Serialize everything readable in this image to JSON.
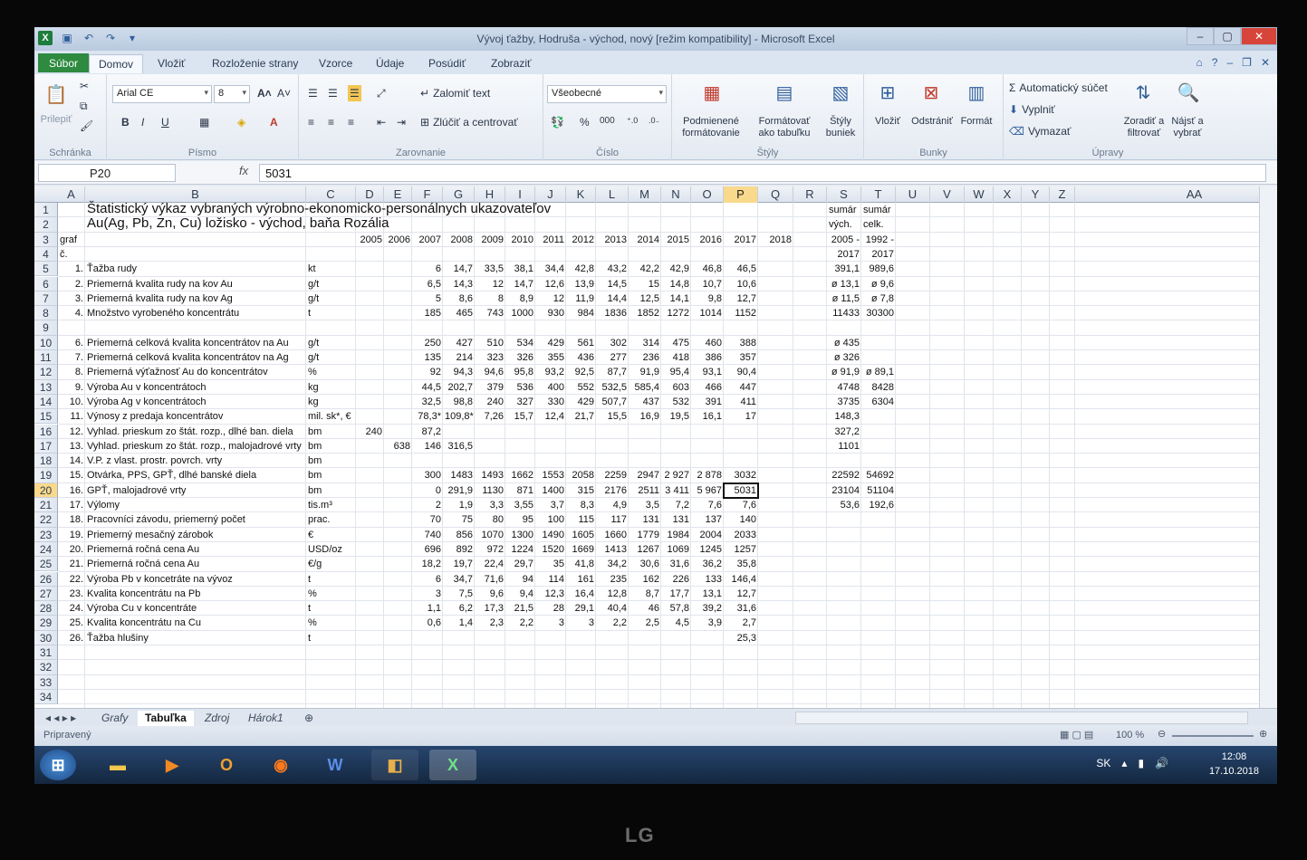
{
  "window": {
    "title": "Vývoj ťažby, Hodruša - východ, nový  [režim kompatibility]  -  Microsoft Excel"
  },
  "ribbon_tabs": [
    "Súbor",
    "Domov",
    "Vložiť",
    "Rozloženie strany",
    "Vzorce",
    "Údaje",
    "Posúdiť",
    "Zobraziť"
  ],
  "ribbon": {
    "paste": "Prilepiť",
    "clipboard": "Schránka",
    "font_name": "Arial CE",
    "font_size": "8",
    "font_group": "Písmo",
    "bold": "B",
    "italic": "I",
    "underline": "U",
    "wrap": "Zalomiť text",
    "merge": "Zlúčiť a centrovať",
    "align_group": "Zarovnanie",
    "numfmt": "Všeobecné",
    "number_group": "Číslo",
    "percent": "%",
    "thousands": "000",
    "cond_fmt": "Podmienené\nformátovanie",
    "fmt_table": "Formátovať\nako tabuľku",
    "cell_styles": "Štýly\nbuniek",
    "styles_group": "Štýly",
    "insert": "Vložiť",
    "delete": "Odstrániť",
    "format": "Formát",
    "cells_group": "Bunky",
    "autosum": "Automatický súčet",
    "fill": "Vyplniť",
    "clear": "Vymazať",
    "sort": "Zoradiť a\nfiltrovať",
    "find": "Nájsť a\nvybrať",
    "edit_group": "Úpravy"
  },
  "formula_bar": {
    "name_box": "P20",
    "fx": "fx",
    "value": "5031"
  },
  "columns": [
    "A",
    "B",
    "C",
    "D",
    "E",
    "F",
    "G",
    "H",
    "I",
    "J",
    "K",
    "L",
    "M",
    "N",
    "O",
    "P",
    "Q",
    "R",
    "S",
    "T",
    "U",
    "V",
    "W",
    "X",
    "Y",
    "Z",
    "AA"
  ],
  "selected_col": "P",
  "selected_row": 20,
  "sheet": {
    "title1": "Štatistický výkaz vybraných výrobno-ekonomicko-personálnych ukazovateľov",
    "title2": "Au(Ag, Pb, Zn, Cu) ložisko - východ, baňa Rozália",
    "graf": "graf",
    "c": "č.",
    "years": [
      "2005",
      "2006",
      "2007",
      "2008",
      "2009",
      "2010",
      "2011",
      "2012",
      "2013",
      "2014",
      "2015",
      "2016",
      "2017",
      "2018"
    ],
    "s_head": [
      "sumár",
      "vých.",
      "2005 -",
      "2017"
    ],
    "t_head": [
      "sumár",
      "celk.",
      "1992 -",
      "2017"
    ],
    "rows": [
      {
        "r": 5,
        "a": "1.",
        "b": "Ťažba rudy",
        "c": "kt",
        "f": "6",
        "g": "14,7",
        "h": "33,5",
        "i": "38,1",
        "j": "34,4",
        "k": "42,8",
        "l": "43,2",
        "m": "42,2",
        "n": "42,9",
        "o": "46,8",
        "p": "46,5",
        "s": "391,1",
        "t": "989,6"
      },
      {
        "r": 6,
        "a": "2.",
        "b": "Priemerná kvalita rudy na kov Au",
        "c": "g/t",
        "f": "6,5",
        "g": "14,3",
        "h": "12",
        "i": "14,7",
        "j": "12,6",
        "k": "13,9",
        "l": "14,5",
        "m": "15",
        "n": "14,8",
        "o": "10,7",
        "p": "10,6",
        "s": "ø 13,1",
        "t": "ø 9,6"
      },
      {
        "r": 7,
        "a": "3.",
        "b": "Priemerná kvalita rudy na kov Ag",
        "c": "g/t",
        "f": "5",
        "g": "8,6",
        "h": "8",
        "i": "8,9",
        "j": "12",
        "k": "11,9",
        "l": "14,4",
        "m": "12,5",
        "n": "14,1",
        "o": "9,8",
        "p": "12,7",
        "s": "ø 11,5",
        "t": "ø 7,8"
      },
      {
        "r": 8,
        "a": "4.",
        "b": "Množstvo vyrobeného koncentrátu",
        "c": "t",
        "f": "185",
        "g": "465",
        "h": "743",
        "i": "1000",
        "j": "930",
        "k": "984",
        "l": "1836",
        "m": "1852",
        "n": "1272",
        "o": "1014",
        "p": "1152",
        "s": "11433",
        "t": "30300"
      },
      {
        "r": 10,
        "a": "6.",
        "b": "Priemerná celková kvalita koncentrátov na Au",
        "c": "g/t",
        "f": "250",
        "g": "427",
        "h": "510",
        "i": "534",
        "j": "429",
        "k": "561",
        "l": "302",
        "m": "314",
        "n": "475",
        "o": "460",
        "p": "388",
        "s": "ø 435",
        "t": ""
      },
      {
        "r": 11,
        "a": "7.",
        "b": "Priemerná celková kvalita koncentrátov na Ag",
        "c": "g/t",
        "f": "135",
        "g": "214",
        "h": "323",
        "i": "326",
        "j": "355",
        "k": "436",
        "l": "277",
        "m": "236",
        "n": "418",
        "o": "386",
        "p": "357",
        "s": "ø 326",
        "t": ""
      },
      {
        "r": 12,
        "a": "8.",
        "b": "Priemerná výťažnosť Au do koncentrátov",
        "c": "%",
        "f": "92",
        "g": "94,3",
        "h": "94,6",
        "i": "95,8",
        "j": "93,2",
        "k": "92,5",
        "l": "87,7",
        "m": "91,9",
        "n": "95,4",
        "o": "93,1",
        "p": "90,4",
        "s": "ø 91,9",
        "t": "ø 89,1"
      },
      {
        "r": 13,
        "a": "9.",
        "b": "Výroba Au v koncentrátoch",
        "c": "kg",
        "f": "44,5",
        "g": "202,7",
        "h": "379",
        "i": "536",
        "j": "400",
        "k": "552",
        "l": "532,5",
        "m": "585,4",
        "n": "603",
        "o": "466",
        "p": "447",
        "s": "4748",
        "t": "8428"
      },
      {
        "r": 14,
        "a": "10.",
        "b": "Výroba Ag v koncentrátoch",
        "c": "kg",
        "f": "32,5",
        "g": "98,8",
        "h": "240",
        "i": "327",
        "j": "330",
        "k": "429",
        "l": "507,7",
        "m": "437",
        "n": "532",
        "o": "391",
        "p": "411",
        "s": "3735",
        "t": "6304"
      },
      {
        "r": 15,
        "a": "11.",
        "b": "Výnosy z predaja koncentrátov",
        "c": "mil. sk*, €",
        "f": "78,3*",
        "g": "109,8*",
        "h": "7,26",
        "i": "15,7",
        "j": "12,4",
        "k": "21,7",
        "l": "15,5",
        "m": "16,9",
        "n": "19,5",
        "o": "16,1",
        "p": "17",
        "s": "148,3",
        "t": ""
      },
      {
        "r": 16,
        "a": "12.",
        "b": "Vyhlad. prieskum zo štát. rozp., dlhé ban. diela",
        "c": "bm",
        "d": "240",
        "f": "87,2",
        "s": "327,2",
        "t": ""
      },
      {
        "r": 17,
        "a": "13.",
        "b": "Vyhlad. prieskum zo štát. rozp., malojadrové vrty",
        "c": "bm",
        "e": "638",
        "f": "146",
        "g": "316,5",
        "s": "1101",
        "t": ""
      },
      {
        "r": 18,
        "a": "14.",
        "b": "V.P. z vlast. prostr. povrch. vrty",
        "c": "bm"
      },
      {
        "r": 19,
        "a": "15.",
        "b": "Otvárka, PPS, GPŤ, dlhé banské diela",
        "c": "bm",
        "f": "300",
        "g": "1483",
        "h": "1493",
        "i": "1662",
        "j": "1553",
        "k": "2058",
        "l": "2259",
        "m": "2947",
        "n": "2 927",
        "o": "2 878",
        "p": "3032",
        "s": "22592",
        "t": "54692"
      },
      {
        "r": 20,
        "a": "16.",
        "b": "GPŤ, malojadrové vrty",
        "c": "bm",
        "f": "0",
        "g": "291,9",
        "h": "1130",
        "i": "871",
        "j": "1400",
        "k": "315",
        "l": "2176",
        "m": "2511",
        "n": "3 411",
        "o": "5 967",
        "p": "5031",
        "s": "23104",
        "t": "51104"
      },
      {
        "r": 21,
        "a": "17.",
        "b": "Výlomy",
        "c": "tis.m³",
        "f": "2",
        "g": "1,9",
        "h": "3,3",
        "i": "3,55",
        "j": "3,7",
        "k": "8,3",
        "l": "4,9",
        "m": "3,5",
        "n": "7,2",
        "o": "7,6",
        "p": "7,6",
        "s": "53,6",
        "t": "192,6"
      },
      {
        "r": 22,
        "a": "18.",
        "b": "Pracovníci závodu, priemerný počet",
        "c": "prac.",
        "f": "70",
        "g": "75",
        "h": "80",
        "i": "95",
        "j": "100",
        "k": "115",
        "l": "117",
        "m": "131",
        "n": "131",
        "o": "137",
        "p": "140"
      },
      {
        "r": 23,
        "a": "19.",
        "b": "Priemerný mesačný zárobok",
        "c": "€",
        "f": "740",
        "g": "856",
        "h": "1070",
        "i": "1300",
        "j": "1490",
        "k": "1605",
        "l": "1660",
        "m": "1779",
        "n": "1984",
        "o": "2004",
        "p": "2033"
      },
      {
        "r": 24,
        "a": "20.",
        "b": "Priemerná ročná cena Au",
        "c": "USD/oz",
        "f": "696",
        "g": "892",
        "h": "972",
        "i": "1224",
        "j": "1520",
        "k": "1669",
        "l": "1413",
        "m": "1267",
        "n": "1069",
        "o": "1245",
        "p": "1257"
      },
      {
        "r": 25,
        "a": "21.",
        "b": "Priemerná ročná cena Au",
        "c": "€/g",
        "f": "18,2",
        "g": "19,7",
        "h": "22,4",
        "i": "29,7",
        "j": "35",
        "k": "41,8",
        "l": "34,2",
        "m": "30,6",
        "n": "31,6",
        "o": "36,2",
        "p": "35,8"
      },
      {
        "r": 26,
        "a": "22.",
        "b": "Výroba Pb v koncetráte na vývoz",
        "c": "t",
        "f": "6",
        "g": "34,7",
        "h": "71,6",
        "i": "94",
        "j": "114",
        "k": "161",
        "l": "235",
        "m": "162",
        "n": "226",
        "o": "133",
        "p": "146,4"
      },
      {
        "r": 27,
        "a": "23.",
        "b": "Kvalita koncentrátu na Pb",
        "c": "%",
        "f": "3",
        "g": "7,5",
        "h": "9,6",
        "i": "9,4",
        "j": "12,3",
        "k": "16,4",
        "l": "12,8",
        "m": "8,7",
        "n": "17,7",
        "o": "13,1",
        "p": "12,7"
      },
      {
        "r": 28,
        "a": "24.",
        "b": "Výroba Cu v koncentráte",
        "c": "t",
        "f": "1,1",
        "g": "6,2",
        "h": "17,3",
        "i": "21,5",
        "j": "28",
        "k": "29,1",
        "l": "40,4",
        "m": "46",
        "n": "57,8",
        "o": "39,2",
        "p": "31,6"
      },
      {
        "r": 29,
        "a": "25.",
        "b": "Kvalita koncentrátu na Cu",
        "c": "%",
        "f": "0,6",
        "g": "1,4",
        "h": "2,3",
        "i": "2,2",
        "j": "3",
        "k": "3",
        "l": "2,2",
        "m": "2,5",
        "n": "4,5",
        "o": "3,9",
        "p": "2,7"
      },
      {
        "r": 30,
        "a": "26.",
        "b": "Ťažba hlušiny",
        "c": "t",
        "p": "25,3"
      }
    ]
  },
  "sheet_tabs": [
    "Grafy",
    "Tabuľka",
    "Zdroj",
    "Hárok1"
  ],
  "active_sheet": "Tabuľka",
  "status": {
    "ready": "Pripravený",
    "zoom": "100 %"
  },
  "taskbar": {
    "lang": "SK",
    "time": "12:08",
    "date": "17.10.2018"
  },
  "monitor_brand": "LG"
}
